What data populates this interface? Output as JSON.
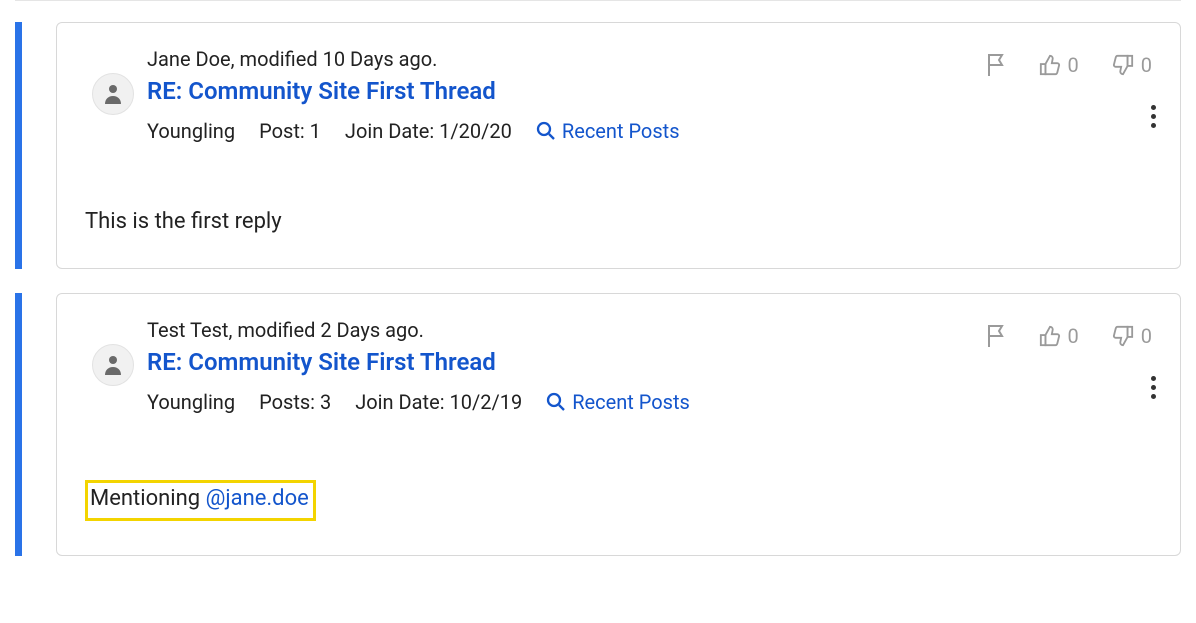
{
  "posts": [
    {
      "byline": "Jane Doe, modified 10 Days ago.",
      "title": "RE: Community Site First Thread",
      "rank": "Youngling",
      "post_count_label": "Post: 1",
      "join_label": "Join Date: 1/20/20",
      "recent_label": "Recent Posts",
      "like_count": "0",
      "dislike_count": "0",
      "body": "This is the first reply",
      "mention": ""
    },
    {
      "byline": "Test Test, modified 2 Days ago.",
      "title": "RE: Community Site First Thread",
      "rank": "Youngling",
      "post_count_label": "Posts: 3",
      "join_label": "Join Date: 10/2/19",
      "recent_label": "Recent Posts",
      "like_count": "0",
      "dislike_count": "0",
      "body_prefix": "Mentioning ",
      "mention": "@jane.doe"
    }
  ]
}
